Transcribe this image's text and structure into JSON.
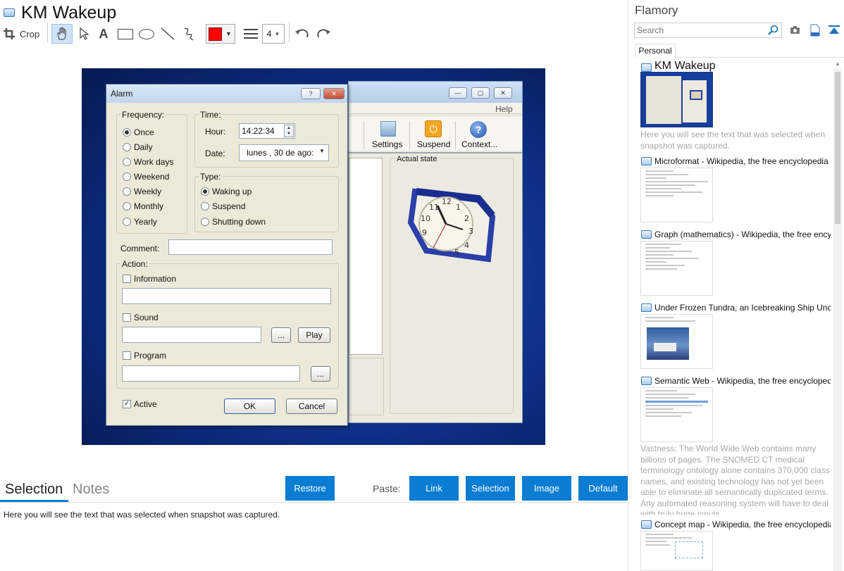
{
  "header": {
    "title": "KM Wakeup",
    "crop_label": "Crop",
    "stroke_width": "4",
    "stroke_color": "#ff0000"
  },
  "screenshot": {
    "dialog": {
      "title": "Alarm",
      "frequency_label": "Frequency:",
      "frequency_options": [
        "Once",
        "Daily",
        "Work days",
        "Weekend",
        "Weekly",
        "Monthly",
        "Yearly"
      ],
      "frequency_selected": "Once",
      "time_label": "Time:",
      "hour_label": "Hour:",
      "hour_value": "14:22:34",
      "date_label": "Date:",
      "date_value": "lunes   , 30 de     ago:",
      "type_label": "Type:",
      "type_options": [
        "Waking up",
        "Suspend",
        "Shutting down"
      ],
      "type_selected": "Waking up",
      "comment_label": "Comment:",
      "action_label": "Action:",
      "information_label": "Information",
      "sound_label": "Sound",
      "browse_label": "...",
      "play_label": "Play",
      "program_label": "Program",
      "active_label": "Active",
      "active_checked": true,
      "ok_label": "OK",
      "cancel_label": "Cancel"
    },
    "main_window": {
      "help_menu": "Help",
      "toolbar": [
        "Settings",
        "Suspend",
        "Context..."
      ],
      "actual_state_label": "Actual state"
    }
  },
  "bottom": {
    "tabs": [
      "Selection",
      "Notes"
    ],
    "active_tab": "Selection",
    "restore_label": "Restore",
    "paste_label": "Paste:",
    "paste_buttons": [
      "Link",
      "Selection",
      "Image",
      "Default"
    ],
    "selection_text": "Here you will see the text that was selected when snapshot was captured."
  },
  "sidebar": {
    "app_name": "Flamory",
    "search_placeholder": "Search",
    "tab": "Personal",
    "items": [
      {
        "title": "KM Wakeup",
        "description": "Here you will see the text that was selected when snapshot was captured."
      },
      {
        "title": "Microformat - Wikipedia, the free encyclopedia"
      },
      {
        "title": "Graph (mathematics) - Wikipedia, the free encyclopedia"
      },
      {
        "title": "Under Frozen Tundra, an Icebreaking Ship Uncovers"
      },
      {
        "title": "Semantic Web - Wikipedia, the free encyclopedia",
        "description": "Vastness: The World Wide Web contains many billions of pages. The SNOMED CT medical terminology ontology alone contains 370,000 class names, and existing technology has not yet been able to eliminate all semantically duplicated terms. Any automated reasoning system will have to deal with truly huge inputs."
      },
      {
        "title": "Concept map - Wikipedia, the free encyclopedia"
      }
    ]
  },
  "colors": {
    "accent": "#0a7dd3",
    "tab_underline": "#0a7dd3"
  }
}
